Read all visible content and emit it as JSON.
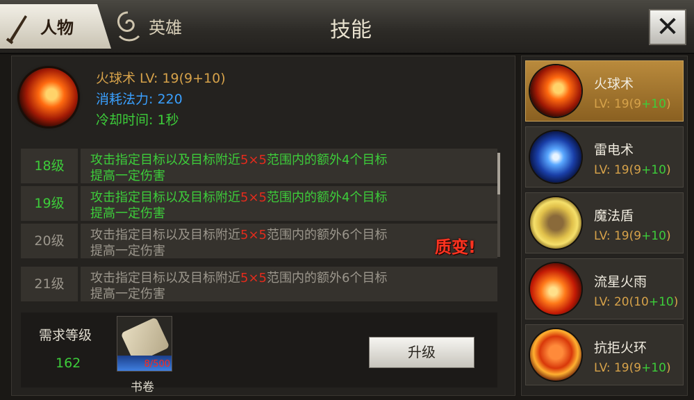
{
  "tabs": [
    {
      "label": "人物",
      "active": true
    },
    {
      "label": "英雄",
      "active": false
    }
  ],
  "title": "技能",
  "close_label": "✕",
  "selected_skill": {
    "name_line": "火球术 LV: 19(9+10)",
    "cost_line": "消耗法力: 220",
    "cooldown_line": "冷却时间: 1秒"
  },
  "levels": [
    {
      "level": "18级",
      "pre": "攻击指定目标以及目标附近",
      "range": "5×5",
      "post": "范围内的额外4个目标",
      "line2": "提高一定伤害",
      "unlocked": true
    },
    {
      "level": "19级",
      "pre": "攻击指定目标以及目标附近",
      "range": "5×5",
      "post": "范围内的额外4个目标",
      "line2": "提高一定伤害",
      "unlocked": true
    },
    {
      "level": "20级",
      "pre": "攻击指定目标以及目标附近",
      "range": "5×5",
      "post": "范围内的额外6个目标",
      "line2": "提高一定伤害",
      "unlocked": false
    },
    {
      "level": "21级",
      "pre": "攻击指定目标以及目标附近",
      "range": "5×5",
      "post": "范围内的额外6个目标",
      "line2": "提高一定伤害",
      "unlocked": false
    }
  ],
  "quality_change": "质变!",
  "requirement": {
    "label": "需求等级",
    "value": "162"
  },
  "item": {
    "count": "8/500",
    "label": "书卷"
  },
  "upgrade_label": "升级",
  "skills": [
    {
      "name": "火球术",
      "lv_prefix": "LV: 19(9",
      "lv_bonus": "+10",
      "lv_suffix": ")",
      "icon": "fireball-icon"
    },
    {
      "name": "雷电术",
      "lv_prefix": "LV: 19(9",
      "lv_bonus": "+10",
      "lv_suffix": ")",
      "icon": "lightning-icon"
    },
    {
      "name": "魔法盾",
      "lv_prefix": "LV: 19(9",
      "lv_bonus": "+10",
      "lv_suffix": ")",
      "icon": "magic-shield-icon"
    },
    {
      "name": "流星火雨",
      "lv_prefix": "LV: 20(10",
      "lv_bonus": "+10",
      "lv_suffix": ")",
      "icon": "meteor-shower-icon"
    },
    {
      "name": "抗拒火环",
      "lv_prefix": "LV: 19(9",
      "lv_bonus": "+10",
      "lv_suffix": ")",
      "icon": "repel-fire-ring-icon"
    }
  ],
  "colors": {
    "green": "#3dcd3a",
    "red": "#e32b1c",
    "gold": "#d6a24a",
    "blue": "#3aa0ff"
  }
}
